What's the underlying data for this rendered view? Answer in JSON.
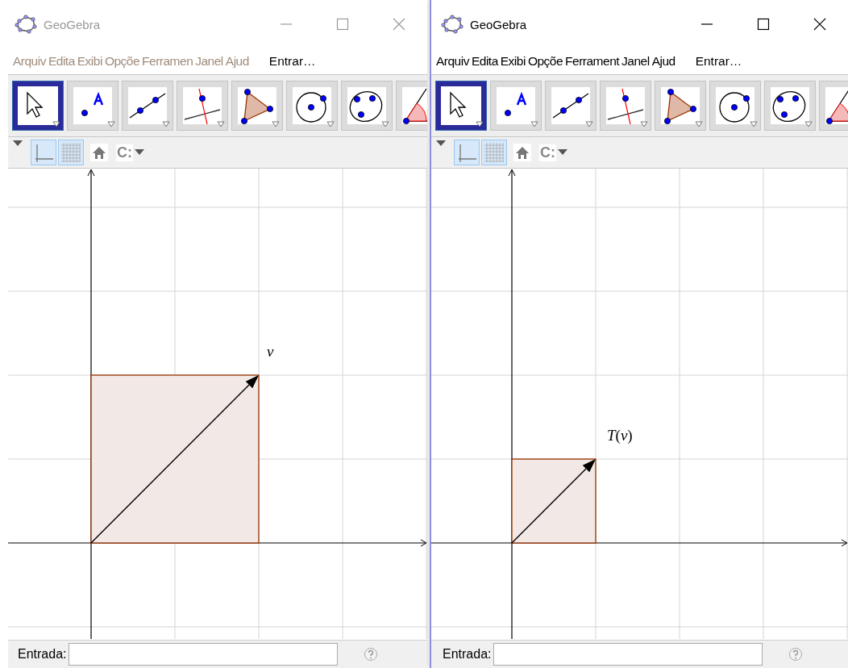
{
  "windows": [
    {
      "title": "GeoGebra",
      "active": false,
      "menu": [
        "Arquiv",
        "Edita",
        "Exibi",
        "Opçõe",
        "Ferramen",
        "Janel",
        "Ajud"
      ],
      "login": "Entrar…",
      "tools": [
        {
          "kind": "move",
          "selected": true
        },
        {
          "kind": "point",
          "selected": false
        },
        {
          "kind": "line",
          "selected": false
        },
        {
          "kind": "perpendicular",
          "selected": false
        },
        {
          "kind": "polygon",
          "selected": false
        },
        {
          "kind": "circle",
          "selected": false
        },
        {
          "kind": "conic",
          "selected": false
        },
        {
          "kind": "angle",
          "selected": false
        }
      ],
      "style_bar": {
        "axes": {
          "selected": true
        },
        "grid": {
          "selected": true
        },
        "caption": "C:"
      },
      "graphics": {
        "kind": "double",
        "vector_label": "v"
      },
      "input": {
        "label": "Entrada:"
      }
    },
    {
      "title": "GeoGebra",
      "active": true,
      "menu": [
        "Arquiv",
        "Edita",
        "Exibi",
        "Opçõe",
        "Ferrament",
        "Janel",
        "Ajud"
      ],
      "login": "Entrar…",
      "tools": [
        {
          "kind": "move",
          "selected": true
        },
        {
          "kind": "point",
          "selected": false
        },
        {
          "kind": "line",
          "selected": false
        },
        {
          "kind": "perpendicular",
          "selected": false
        },
        {
          "kind": "polygon",
          "selected": false
        },
        {
          "kind": "circle",
          "selected": false
        },
        {
          "kind": "conic",
          "selected": false
        },
        {
          "kind": "angle",
          "selected": false
        }
      ],
      "style_bar": {
        "axes": {
          "selected": true
        },
        "grid": {
          "selected": true
        },
        "caption": "C:"
      },
      "graphics": {
        "kind": "single",
        "vector_label": "*T*(*v*)"
      },
      "input": {
        "label": "Entrada:"
      }
    }
  ]
}
